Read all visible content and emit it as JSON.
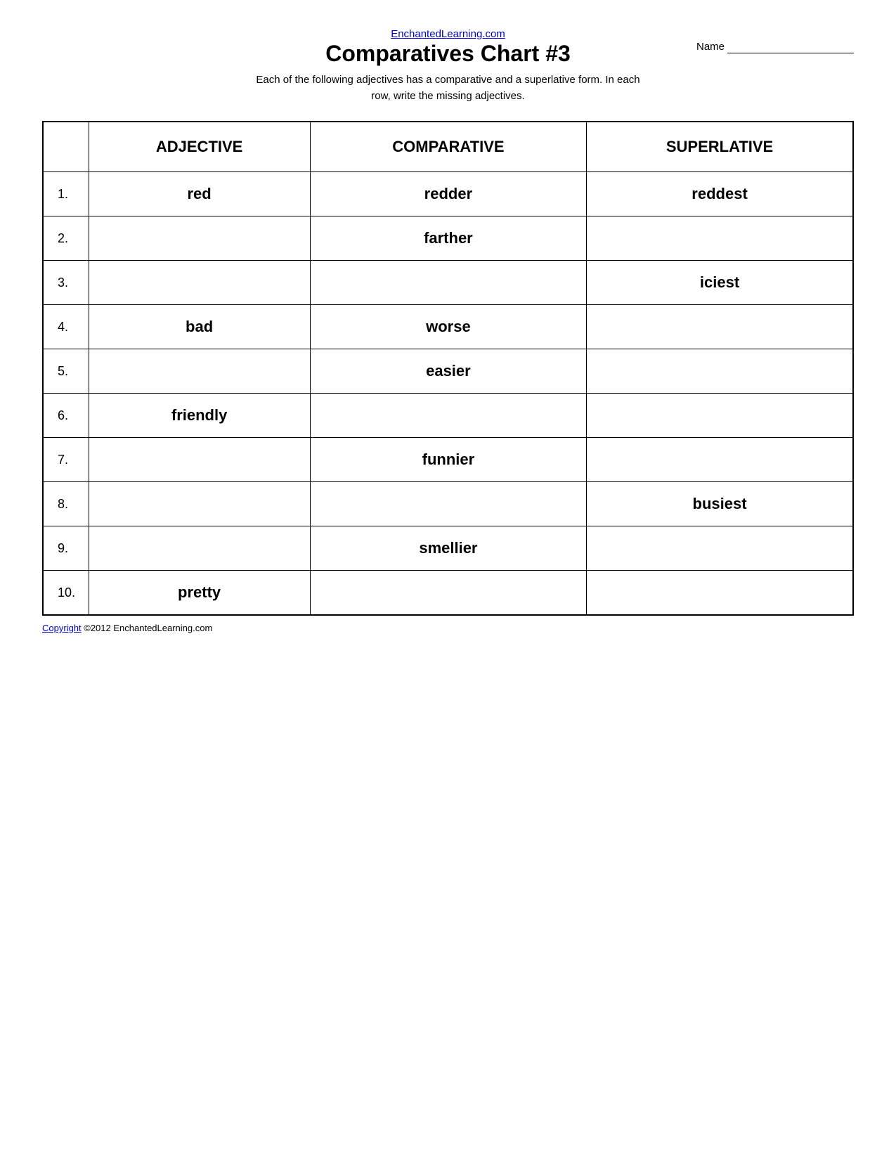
{
  "header": {
    "site_link_text": "EnchantedLearning.com",
    "site_link_url": "#",
    "title": "Comparatives Chart #3",
    "name_label": "Name",
    "subtitle_line1": "Each of the following adjectives has a comparative and a superlative form. In each",
    "subtitle_line2": "row, write the missing adjectives."
  },
  "table": {
    "col_headers": [
      "ADJECTIVE",
      "COMPARATIVE",
      "SUPERLATIVE"
    ],
    "rows": [
      {
        "num": "1.",
        "adjective": "red",
        "comparative": "redder",
        "superlative": "reddest"
      },
      {
        "num": "2.",
        "adjective": "",
        "comparative": "farther",
        "superlative": ""
      },
      {
        "num": "3.",
        "adjective": "",
        "comparative": "",
        "superlative": "iciest"
      },
      {
        "num": "4.",
        "adjective": "bad",
        "comparative": "worse",
        "superlative": ""
      },
      {
        "num": "5.",
        "adjective": "",
        "comparative": "easier",
        "superlative": ""
      },
      {
        "num": "6.",
        "adjective": "friendly",
        "comparative": "",
        "superlative": ""
      },
      {
        "num": "7.",
        "adjective": "",
        "comparative": "funnier",
        "superlative": ""
      },
      {
        "num": "8.",
        "adjective": "",
        "comparative": "",
        "superlative": "busiest"
      },
      {
        "num": "9.",
        "adjective": "",
        "comparative": "smellier",
        "superlative": ""
      },
      {
        "num": "10.",
        "adjective": "pretty",
        "comparative": "",
        "superlative": ""
      }
    ]
  },
  "footer": {
    "copyright_text": "Copyright",
    "year_and_site": " ©2012 EnchantedLearning.com"
  }
}
